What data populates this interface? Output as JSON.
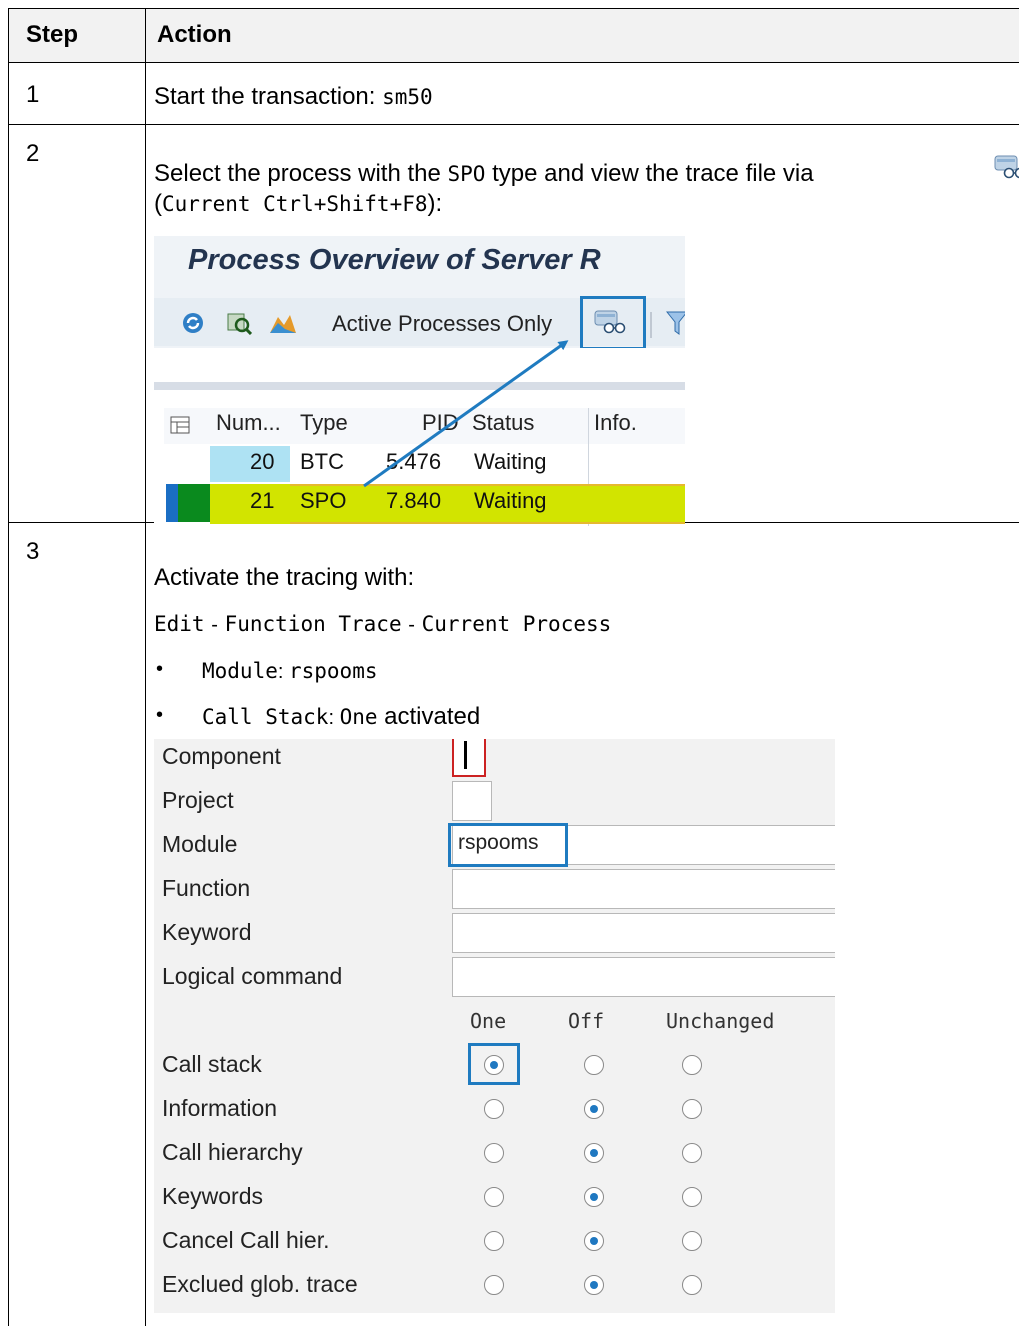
{
  "table": {
    "headers": {
      "step": "Step",
      "action": "Action"
    },
    "rows": [
      {
        "step": "1",
        "text": "Start the transaction: ",
        "code": "sm50"
      },
      {
        "step": "2",
        "text_a": "Select the process with the ",
        "code_a": "SPO",
        "text_b": " type and view the trace file via",
        "text_c": "(",
        "code_c": "Current Ctrl+Shift+F8",
        "text_d": "):"
      },
      {
        "step": "3",
        "intro": "Activate the tracing with:",
        "menu_path": [
          "Edit",
          "Function Trace",
          "Current Process"
        ],
        "menu_sep": "-",
        "bullets": [
          {
            "code": "Module",
            "sep": ": ",
            "value": "rspooms"
          },
          {
            "code": "Call Stack",
            "sep": ": ",
            "value": "One",
            "suffix": " activated"
          }
        ]
      }
    ]
  },
  "screenshot1": {
    "title": "Process Overview of Server R",
    "toolbar": {
      "active_only_label": "Active Processes Only"
    },
    "columns": [
      "Num...",
      "Type",
      "PID",
      "Status",
      "Info."
    ],
    "rows": [
      {
        "num": "20",
        "type": "BTC",
        "pid": "5.476",
        "status": "Waiting",
        "highlighted": false
      },
      {
        "num": "21",
        "type": "SPO",
        "pid": "7.840",
        "status": "Waiting",
        "highlighted": true
      }
    ],
    "colors": {
      "highlight_row": "#d2e400",
      "num_cell": "#aee2f3",
      "callout": "#1f7bc0"
    }
  },
  "screenshot2": {
    "fields": [
      {
        "label": "Component",
        "value": ""
      },
      {
        "label": "Project",
        "value": ""
      },
      {
        "label": "Module",
        "value": "rspooms"
      },
      {
        "label": "Function",
        "value": ""
      },
      {
        "label": "Keyword",
        "value": ""
      },
      {
        "label": "Logical command",
        "value": ""
      }
    ],
    "radio_columns": [
      "One",
      "Off",
      "Unchanged"
    ],
    "radio_rows": [
      {
        "label": "Call stack",
        "selected": "One"
      },
      {
        "label": "Information",
        "selected": "Off"
      },
      {
        "label": "Call hierarchy",
        "selected": "Off"
      },
      {
        "label": "Keywords",
        "selected": "Off"
      },
      {
        "label": "Cancel Call hier.",
        "selected": "Off"
      },
      {
        "label": "Exclued glob. trace",
        "selected": "Off"
      }
    ]
  }
}
